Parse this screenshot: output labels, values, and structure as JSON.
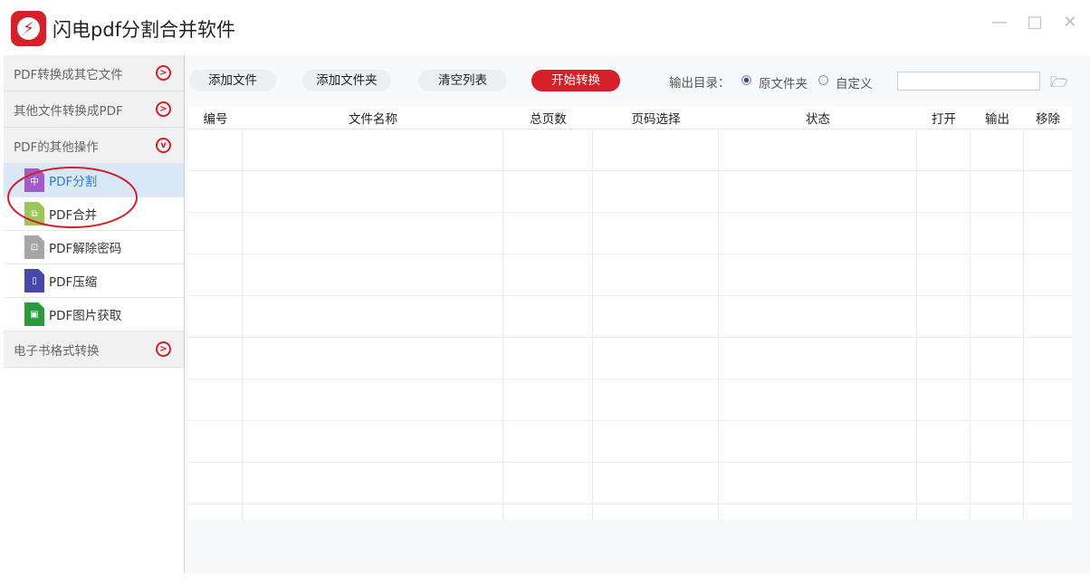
{
  "app": {
    "title": "闪电pdf分割合并软件",
    "logo_glyph": "⚡"
  },
  "window": {
    "minimize": "—",
    "maximize": "□",
    "close": "✕"
  },
  "sidebar": {
    "sections": [
      {
        "label": "PDF转换成其它文件",
        "arrow": ">"
      },
      {
        "label": "其他文件转换成PDF",
        "arrow": ">"
      },
      {
        "label": "PDF的其他操作",
        "arrow": "v"
      },
      {
        "label": "电子书格式转换",
        "arrow": ">"
      }
    ],
    "items": [
      {
        "label": "PDF分割",
        "color": "#a25bc8",
        "glyph": "中"
      },
      {
        "label": "PDF合并",
        "color": "#9cc55a",
        "glyph": "⧉"
      },
      {
        "label": "PDF解除密码",
        "color": "#a6a6a6",
        "glyph": "⊡"
      },
      {
        "label": "PDF压缩",
        "color": "#4848a8",
        "glyph": "▯"
      },
      {
        "label": "PDF图片获取",
        "color": "#2a9a3d",
        "glyph": "▣"
      }
    ]
  },
  "toolbar": {
    "add_file": "添加文件",
    "add_folder": "添加文件夹",
    "clear_list": "清空列表",
    "start": "开始转换",
    "output_label": "输出目录：",
    "opt_original": "原文件夹",
    "opt_custom": "自定义",
    "path_value": "",
    "folder_icon": "🗁"
  },
  "table": {
    "columns": [
      "编号",
      "文件名称",
      "总页数",
      "页码选择",
      "状态",
      "打开",
      "输出",
      "移除"
    ]
  },
  "colors": {
    "accent": "#d5202a",
    "selected": "#d8e8f7"
  }
}
